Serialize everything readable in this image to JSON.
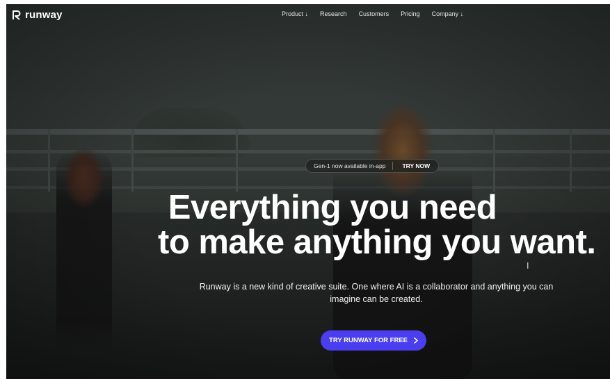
{
  "header": {
    "logo_text": "runway",
    "nav": [
      {
        "label": "Product ↓"
      },
      {
        "label": "Research"
      },
      {
        "label": "Customers"
      },
      {
        "label": "Pricing"
      },
      {
        "label": "Company ↓"
      }
    ]
  },
  "announcement": {
    "text": "Gen-1 now available in-app",
    "cta": "TRY NOW"
  },
  "hero": {
    "headline_line1": "Everything you need",
    "headline_line2": "to make anything you want.",
    "subtext": "Runway is a new kind of creative suite. One where AI is a collaborator and anything you can imagine can be created.",
    "cta_label": "TRY RUNWAY FOR FREE",
    "cta_icon": "chevron-right-icon"
  },
  "colors": {
    "accent": "#4a3ef0",
    "text": "#ffffff"
  }
}
